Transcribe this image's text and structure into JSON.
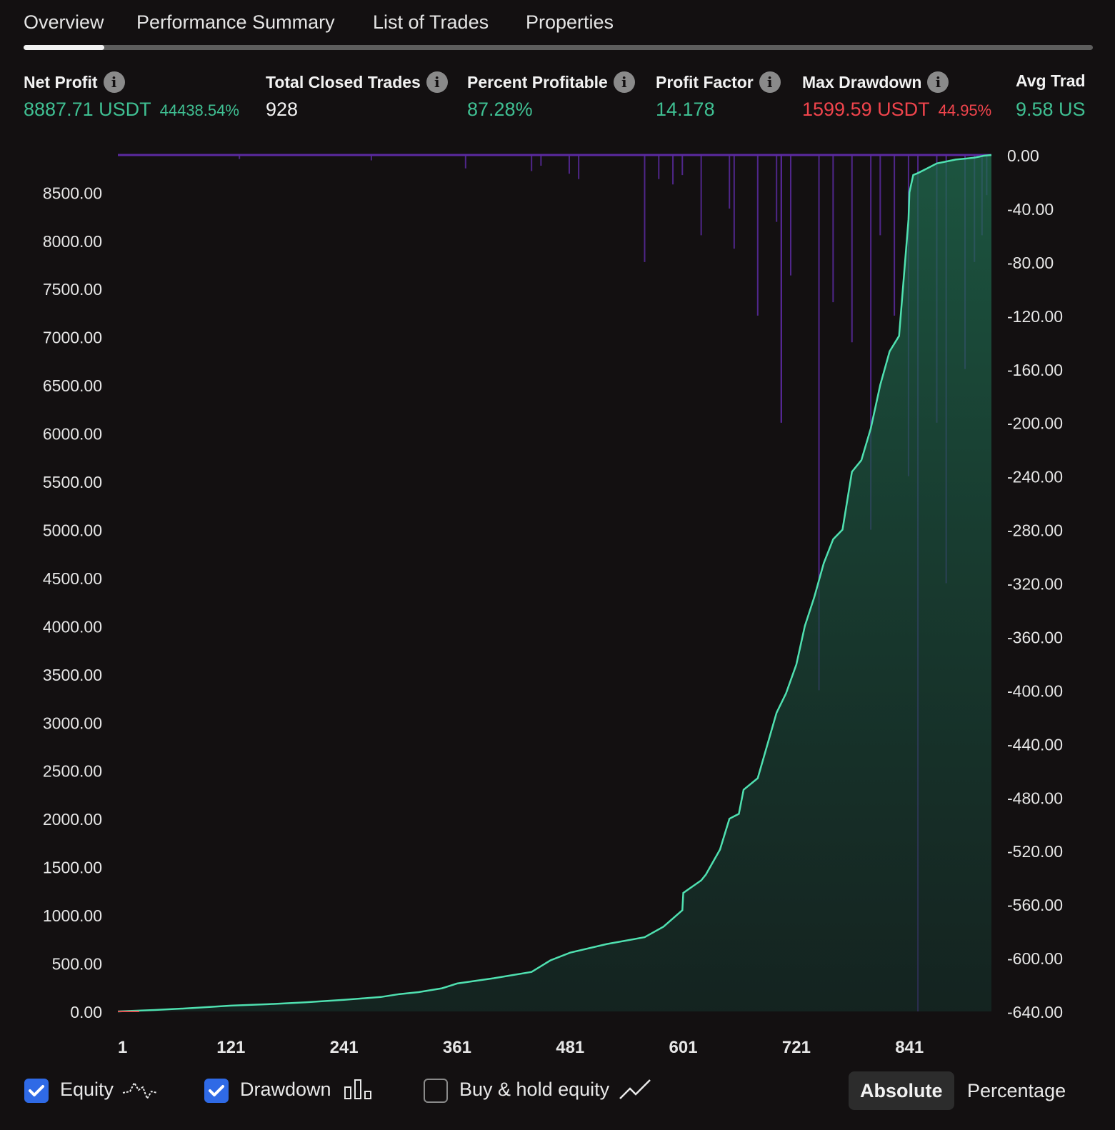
{
  "tabs": [
    {
      "label": "Overview",
      "active": true
    },
    {
      "label": "Performance Summary",
      "active": false
    },
    {
      "label": "List of Trades",
      "active": false
    },
    {
      "label": "Properties",
      "active": false
    }
  ],
  "metrics": {
    "net_profit": {
      "label": "Net Profit",
      "value": "8887.71 USDT",
      "sub": "44438.54%"
    },
    "total_closed_trades": {
      "label": "Total Closed Trades",
      "value": "928"
    },
    "percent_profitable": {
      "label": "Percent Profitable",
      "value": "87.28%"
    },
    "profit_factor": {
      "label": "Profit Factor",
      "value": "14.178"
    },
    "max_drawdown": {
      "label": "Max Drawdown",
      "value": "1599.59 USDT",
      "sub": "44.95%"
    },
    "avg_trade": {
      "label": "Avg Trad",
      "value": "9.58 US"
    }
  },
  "colors": {
    "positive": "#3fbf92",
    "negative": "#f0444c",
    "equity_line": "#4fe0b0",
    "drawdown_bar": "#5b2aa0",
    "checkbox": "#2f6ae6"
  },
  "chart_data": {
    "type": "area",
    "left_axis_ticks": [
      "0.00",
      "500.00",
      "1000.00",
      "1500.00",
      "2000.00",
      "2500.00",
      "3000.00",
      "3500.00",
      "4000.00",
      "4500.00",
      "5000.00",
      "5500.00",
      "6000.00",
      "6500.00",
      "7000.00",
      "7500.00",
      "8000.00",
      "8500.00"
    ],
    "right_axis_ticks": [
      "0.00",
      "-40.00",
      "-80.00",
      "-120.00",
      "-160.00",
      "-200.00",
      "-240.00",
      "-280.00",
      "-320.00",
      "-360.00",
      "-400.00",
      "-440.00",
      "-480.00",
      "-520.00",
      "-560.00",
      "-600.00",
      "-640.00"
    ],
    "x_ticks": [
      "1",
      "121",
      "241",
      "361",
      "481",
      "601",
      "721",
      "841"
    ],
    "ylim_left": [
      0,
      8887.71
    ],
    "ylim_right": [
      -640,
      0
    ],
    "xlim": [
      1,
      928
    ],
    "series": [
      {
        "name": "Equity",
        "axis": "left",
        "x": [
          1,
          40,
          80,
          121,
          160,
          200,
          241,
          280,
          300,
          320,
          345,
          361,
          400,
          440,
          460,
          481,
          520,
          560,
          580,
          600,
          601,
          620,
          625,
          640,
          650,
          660,
          665,
          680,
          700,
          710,
          721,
          730,
          740,
          750,
          760,
          770,
          780,
          790,
          800,
          810,
          820,
          830,
          840,
          841,
          845,
          850,
          860,
          870,
          880,
          890,
          900,
          910,
          915,
          920,
          928
        ],
        "values": [
          0,
          15,
          35,
          60,
          75,
          95,
          120,
          150,
          180,
          200,
          240,
          290,
          345,
          410,
          530,
          610,
          700,
          770,
          880,
          1050,
          1230,
          1360,
          1420,
          1680,
          2000,
          2050,
          2300,
          2420,
          3100,
          3300,
          3600,
          4000,
          4300,
          4650,
          4900,
          5000,
          5600,
          5720,
          6050,
          6500,
          6850,
          7010,
          8220,
          8500,
          8680,
          8700,
          8750,
          8800,
          8820,
          8840,
          8850,
          8860,
          8870,
          8880,
          8887.71
        ]
      },
      {
        "name": "Drawdown",
        "axis": "right",
        "type": "bar",
        "x": [
          130,
          270,
          370,
          440,
          450,
          480,
          490,
          560,
          575,
          590,
          600,
          620,
          650,
          655,
          680,
          700,
          705,
          705,
          715,
          745,
          760,
          780,
          800,
          810,
          825,
          840,
          850,
          870,
          880,
          900,
          910,
          918,
          923
        ],
        "values": [
          -3,
          -4,
          -10,
          -12,
          -8,
          -14,
          -18,
          -80,
          -18,
          -22,
          -15,
          -60,
          -40,
          -70,
          -120,
          -50,
          -200,
          -200,
          -90,
          -400,
          -110,
          -140,
          -280,
          -60,
          -120,
          -240,
          -640,
          -200,
          -320,
          -160,
          -80,
          -60,
          -30
        ]
      }
    ]
  },
  "legend": {
    "equity": {
      "label": "Equity",
      "checked": true
    },
    "drawdown": {
      "label": "Drawdown",
      "checked": true
    },
    "buy_hold": {
      "label": "Buy & hold equity",
      "checked": false
    }
  },
  "view_mode": {
    "absolute": "Absolute",
    "percentage": "Percentage",
    "active": "absolute"
  }
}
